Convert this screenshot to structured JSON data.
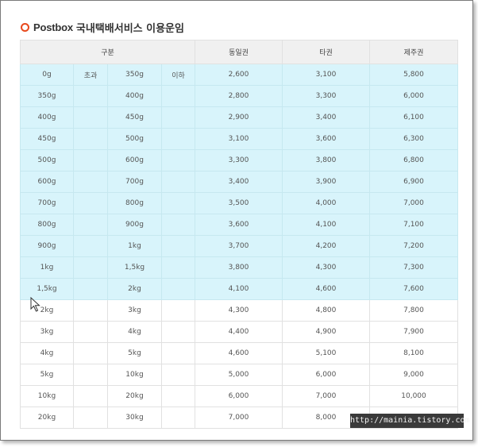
{
  "title": {
    "brand": "Postbox",
    "rest": "국내택배서비스 이용운임"
  },
  "table": {
    "headers": {
      "category": "구분",
      "same_region": "동일권",
      "other_region": "타권",
      "jeju": "제주권"
    },
    "first_row_words": {
      "over": "초과",
      "under": "이하"
    },
    "rows": [
      {
        "from": "0g",
        "to": "350g",
        "same": "2,600",
        "other": "3,100",
        "jeju": "5,800",
        "highlight": true
      },
      {
        "from": "350g",
        "to": "400g",
        "same": "2,800",
        "other": "3,300",
        "jeju": "6,000",
        "highlight": true
      },
      {
        "from": "400g",
        "to": "450g",
        "same": "2,900",
        "other": "3,400",
        "jeju": "6,100",
        "highlight": true
      },
      {
        "from": "450g",
        "to": "500g",
        "same": "3,100",
        "other": "3,600",
        "jeju": "6,300",
        "highlight": true
      },
      {
        "from": "500g",
        "to": "600g",
        "same": "3,300",
        "other": "3,800",
        "jeju": "6,800",
        "highlight": true
      },
      {
        "from": "600g",
        "to": "700g",
        "same": "3,400",
        "other": "3,900",
        "jeju": "6,900",
        "highlight": true
      },
      {
        "from": "700g",
        "to": "800g",
        "same": "3,500",
        "other": "4,000",
        "jeju": "7,000",
        "highlight": true
      },
      {
        "from": "800g",
        "to": "900g",
        "same": "3,600",
        "other": "4,100",
        "jeju": "7,100",
        "highlight": true
      },
      {
        "from": "900g",
        "to": "1kg",
        "same": "3,700",
        "other": "4,200",
        "jeju": "7,200",
        "highlight": true
      },
      {
        "from": "1kg",
        "to": "1,5kg",
        "same": "3,800",
        "other": "4,300",
        "jeju": "7,300",
        "highlight": true
      },
      {
        "from": "1,5kg",
        "to": "2kg",
        "same": "4,100",
        "other": "4,600",
        "jeju": "7,600",
        "highlight": true
      },
      {
        "from": "2kg",
        "to": "3kg",
        "same": "4,300",
        "other": "4,800",
        "jeju": "7,800",
        "highlight": false
      },
      {
        "from": "3kg",
        "to": "4kg",
        "same": "4,400",
        "other": "4,900",
        "jeju": "7,900",
        "highlight": false
      },
      {
        "from": "4kg",
        "to": "5kg",
        "same": "4,600",
        "other": "5,100",
        "jeju": "8,100",
        "highlight": false
      },
      {
        "from": "5kg",
        "to": "10kg",
        "same": "5,000",
        "other": "6,000",
        "jeju": "9,000",
        "highlight": false
      },
      {
        "from": "10kg",
        "to": "20kg",
        "same": "6,000",
        "other": "7,000",
        "jeju": "10,000",
        "highlight": false
      },
      {
        "from": "20kg",
        "to": "30kg",
        "same": "7,000",
        "other": "8,000",
        "jeju": "",
        "highlight": false
      }
    ]
  },
  "watermark": "http://mainia.tistory.com",
  "colors": {
    "bullet": "#e8491d",
    "highlight_row": "#d8f4fb",
    "header_bg": "#f0f0f0",
    "watermark_bg": "#3a3a3a"
  },
  "icons": {
    "title_bullet": "circle-bullet-icon",
    "pointer": "mouse-cursor-icon"
  }
}
